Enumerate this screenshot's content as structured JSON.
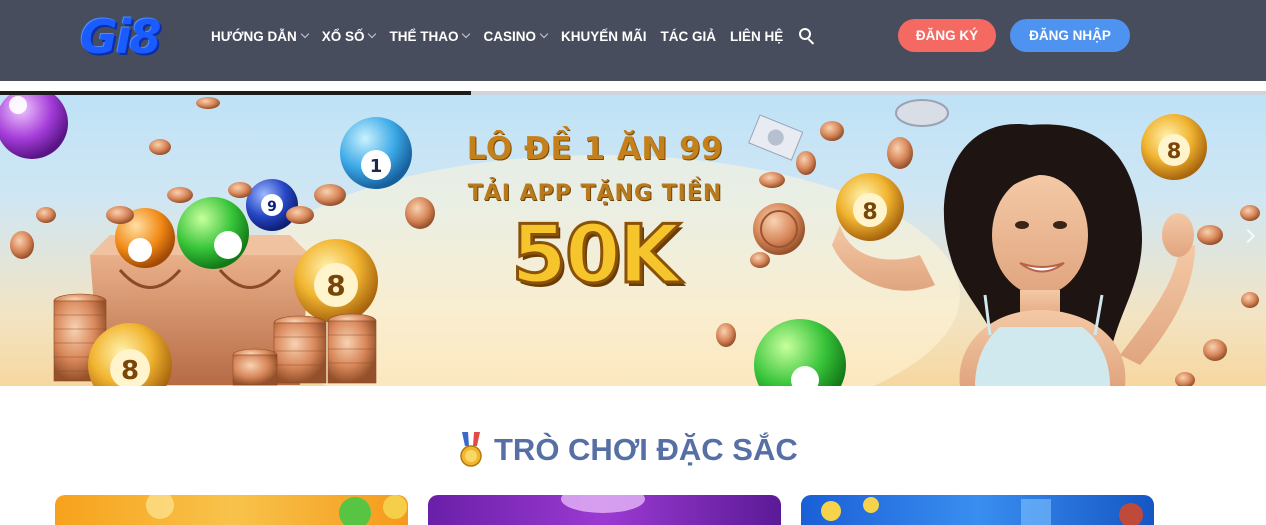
{
  "header": {
    "logo_text": "Gi8",
    "nav": [
      {
        "label": "HƯỚNG DẪN",
        "has_dropdown": true
      },
      {
        "label": "XỔ SỐ",
        "has_dropdown": true
      },
      {
        "label": "THỂ THAO",
        "has_dropdown": true
      },
      {
        "label": "CASINO",
        "has_dropdown": true
      },
      {
        "label": "KHUYẾN MÃI",
        "has_dropdown": false
      },
      {
        "label": "TÁC GIẢ",
        "has_dropdown": false
      },
      {
        "label": "LIÊN HỆ",
        "has_dropdown": false
      }
    ],
    "search_icon": "search-icon",
    "register_label": "ĐĂNG KÝ",
    "login_label": "ĐĂNG NHẬP"
  },
  "slider": {
    "progress": 0.372
  },
  "banner": {
    "line1": "LÔ ĐỀ 1 ĂN 99",
    "line2": "TẢI APP TẶNG TIỀN",
    "line3": "50K"
  },
  "section": {
    "title": "TRÒ CHƠI ĐẶC SẮC",
    "icon": "medal-icon"
  },
  "colors": {
    "header_bg": "#474d5c",
    "register_bg": "#f46a63",
    "login_bg": "#4f93f0",
    "section_title": "#5670a6"
  }
}
